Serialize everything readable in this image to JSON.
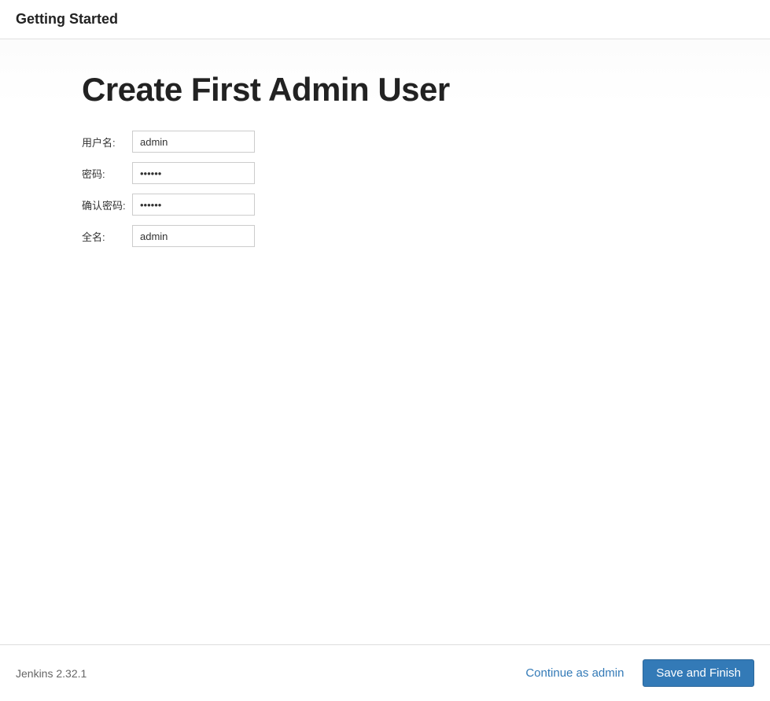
{
  "header": {
    "title": "Getting Started"
  },
  "main": {
    "heading": "Create First Admin User",
    "fields": {
      "username": {
        "label": "用户名:",
        "value": "admin"
      },
      "password": {
        "label": "密码:",
        "value": "••••••"
      },
      "confirm_password": {
        "label": "确认密码:",
        "value": "••••••"
      },
      "fullname": {
        "label": "全名:",
        "value": "admin"
      }
    }
  },
  "footer": {
    "version": "Jenkins 2.32.1",
    "continue_link": "Continue as admin",
    "save_button": "Save and Finish"
  }
}
